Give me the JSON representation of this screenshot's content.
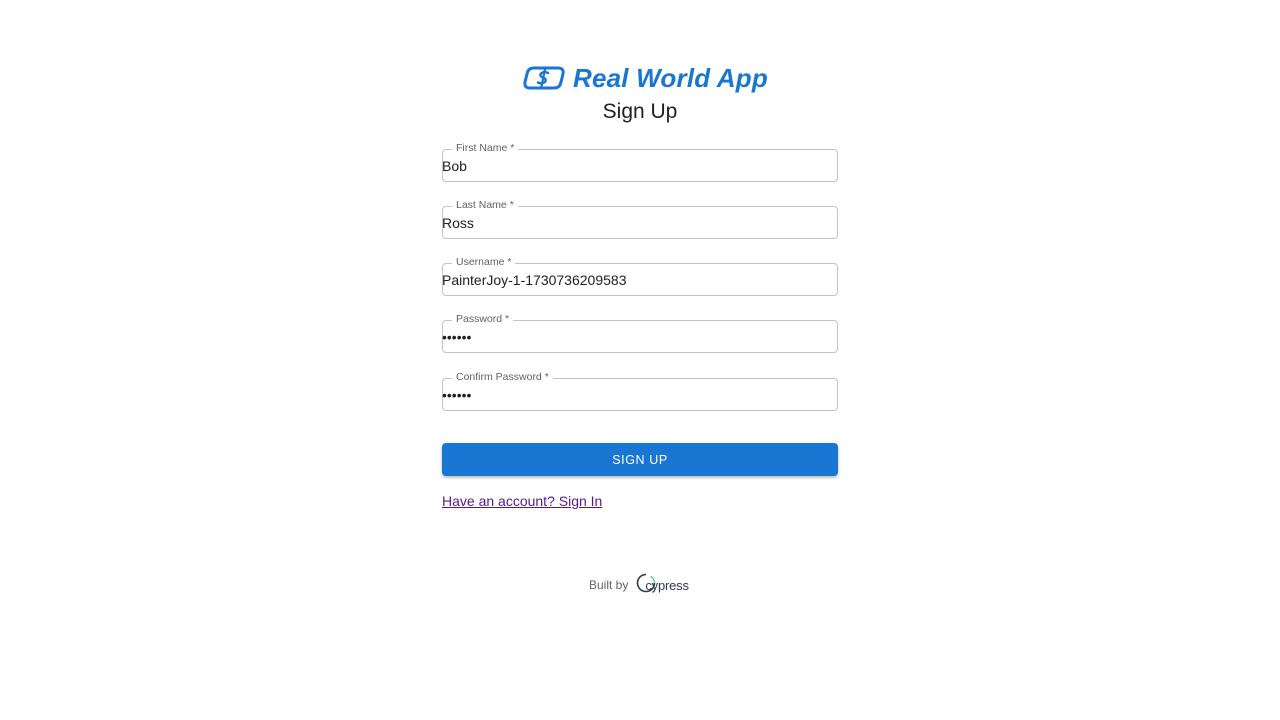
{
  "brand": {
    "name": "Real World App",
    "color": "#1976d2",
    "logo_icon": "dollar-link-icon"
  },
  "page": {
    "title": "Sign Up"
  },
  "form": {
    "fields": [
      {
        "label": "First Name",
        "required_mark": "*",
        "value": "Bob"
      },
      {
        "label": "Last Name",
        "required_mark": "*",
        "value": "Ross"
      },
      {
        "label": "Username",
        "required_mark": "*",
        "value": "PainterJoy-1-1730736209583"
      },
      {
        "label": "Password",
        "required_mark": "*",
        "value": "••••••"
      },
      {
        "label": "Confirm Password",
        "required_mark": "*",
        "value": "••••••"
      }
    ],
    "submit_label": "SIGN UP",
    "signin_link": "Have an account? Sign In"
  },
  "footer": {
    "built_by": "Built by",
    "vendor": "cypress",
    "vendor_icon": "cypress-logo-icon"
  }
}
